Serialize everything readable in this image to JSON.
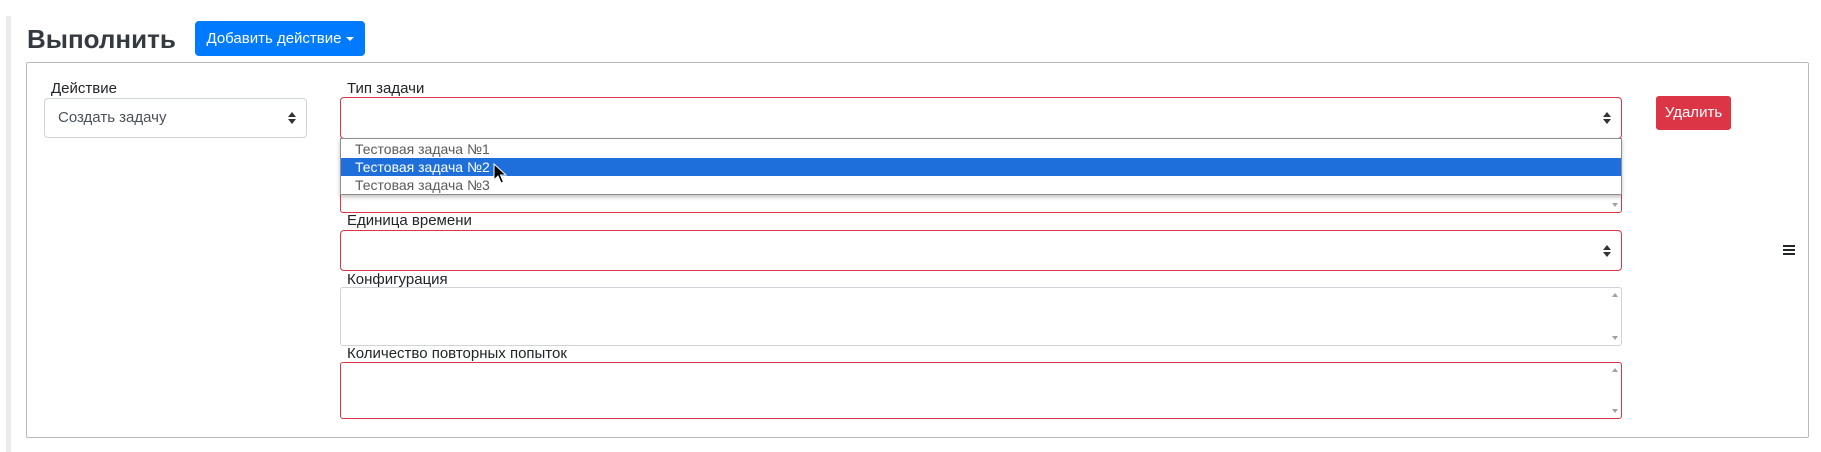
{
  "header": {
    "title": "Выполнить",
    "add_action_label": "Добавить действие"
  },
  "action": {
    "label": "Действие",
    "value": "Создать задачу"
  },
  "task_type": {
    "label": "Тип задачи",
    "value": "",
    "options": [
      {
        "label": "Тестовая задача №1",
        "selected": false
      },
      {
        "label": "Тестовая задача №2",
        "selected": true
      },
      {
        "label": "Тестовая задача №3",
        "selected": false
      }
    ]
  },
  "time_unit": {
    "label": "Единица времени",
    "value": ""
  },
  "configuration": {
    "label": "Конфигурация",
    "value": ""
  },
  "retry_count": {
    "label": "Количество повторных попыток",
    "value": ""
  },
  "delete_label": "Удалить",
  "colors": {
    "primary": "#007bff",
    "danger": "#dc3545",
    "selected_option": "#1e6fd9"
  },
  "icons": [
    "caret-down-icon",
    "select-arrows-icon",
    "drag-handle-icon",
    "mouse-cursor-icon"
  ]
}
